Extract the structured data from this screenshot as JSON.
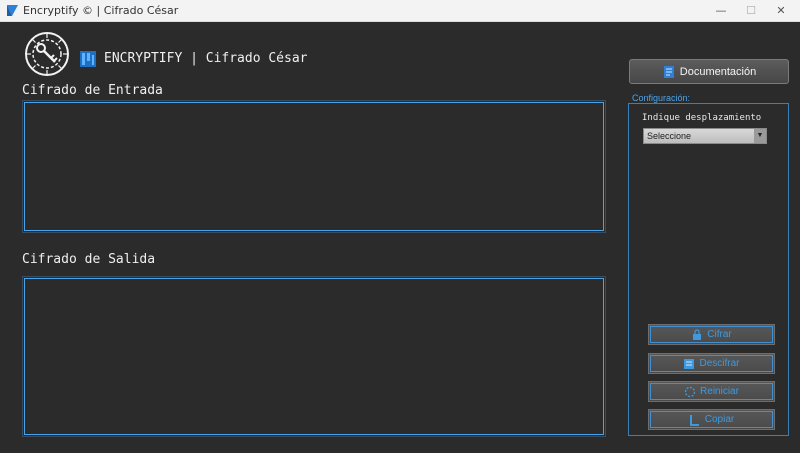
{
  "window": {
    "title": "Encryptify © | Cifrado César",
    "minimize_glyph": "—",
    "maximize_glyph": "☐",
    "close_glyph": "✕"
  },
  "header": {
    "title": "ENCRYPTIFY | Cifrado César",
    "logo_icon": "cipher-wheel-icon",
    "brand_icon": "blue-square-icon"
  },
  "input": {
    "label": "Cifrado de Entrada",
    "value": ""
  },
  "output": {
    "label": "Cifrado de Salida",
    "value": ""
  },
  "documentation_button": {
    "label": "Documentación",
    "icon": "document-icon"
  },
  "config": {
    "legend": "Configuración:",
    "shift_label": "Indique desplazamiento",
    "shift_selected": "Seleccione"
  },
  "actions": {
    "encrypt": "Cifrar",
    "decrypt": "Descifrar",
    "reset": "Reiniciar",
    "copy": "Copiar"
  },
  "colors": {
    "background": "#2b2b2b",
    "accent_blue": "#3d9ae0",
    "border_blue": "#4aa3e6"
  }
}
